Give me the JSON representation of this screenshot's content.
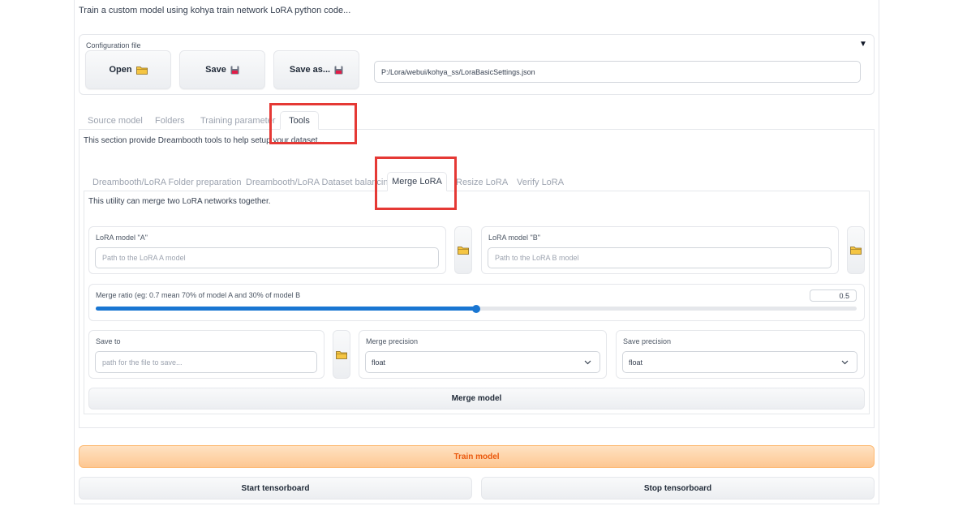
{
  "description": "Train a custom model using kohya train network LoRA python code...",
  "config": {
    "label": "Configuration file",
    "caret": "▼",
    "open_label": "Open",
    "save_label": "Save",
    "save_as_label": "Save as...",
    "file_path": "P:/Lora/webui/kohya_ss/LoraBasicSettings.json"
  },
  "main_tabs": [
    "Source model",
    "Folders",
    "Training parameter",
    "Tools"
  ],
  "tools_description": "This section provide Dreambooth tools to help setup your dataset...",
  "sub_tabs": [
    "Dreambooth/LoRA Folder preparation",
    "Dreambooth/LoRA Dataset balancing",
    "Merge LoRA",
    "Resize LoRA",
    "Verify LoRA"
  ],
  "merge": {
    "description": "This utility can merge two LoRA networks together.",
    "model_a_label": "LoRA model \"A\"",
    "model_a_placeholder": "Path to the LoRA A model",
    "model_b_label": "LoRA model \"B\"",
    "model_b_placeholder": "Path to the LoRA B model",
    "ratio_label": "Merge ratio (eg: 0.7 mean 70% of model A and 30% of model B",
    "ratio_value": "0.5",
    "ratio_fraction": 0.5,
    "save_to_label": "Save to",
    "save_to_placeholder": "path for the file to save...",
    "merge_precision_label": "Merge precision",
    "merge_precision_value": "float",
    "save_precision_label": "Save precision",
    "save_precision_value": "float",
    "merge_button": "Merge model"
  },
  "footer": {
    "train_button": "Train model",
    "start_tensorboard": "Start tensorboard",
    "stop_tensorboard": "Stop tensorboard"
  },
  "colors": {
    "accent_blue": "#1976d2",
    "highlight_red": "#e53935",
    "train_orange": "#ea580c"
  },
  "icons": {
    "open": "folder-icon",
    "save": "floppy-disk-icon",
    "save_as": "floppy-disk-icon",
    "dropdown": "chevron-down-icon"
  }
}
